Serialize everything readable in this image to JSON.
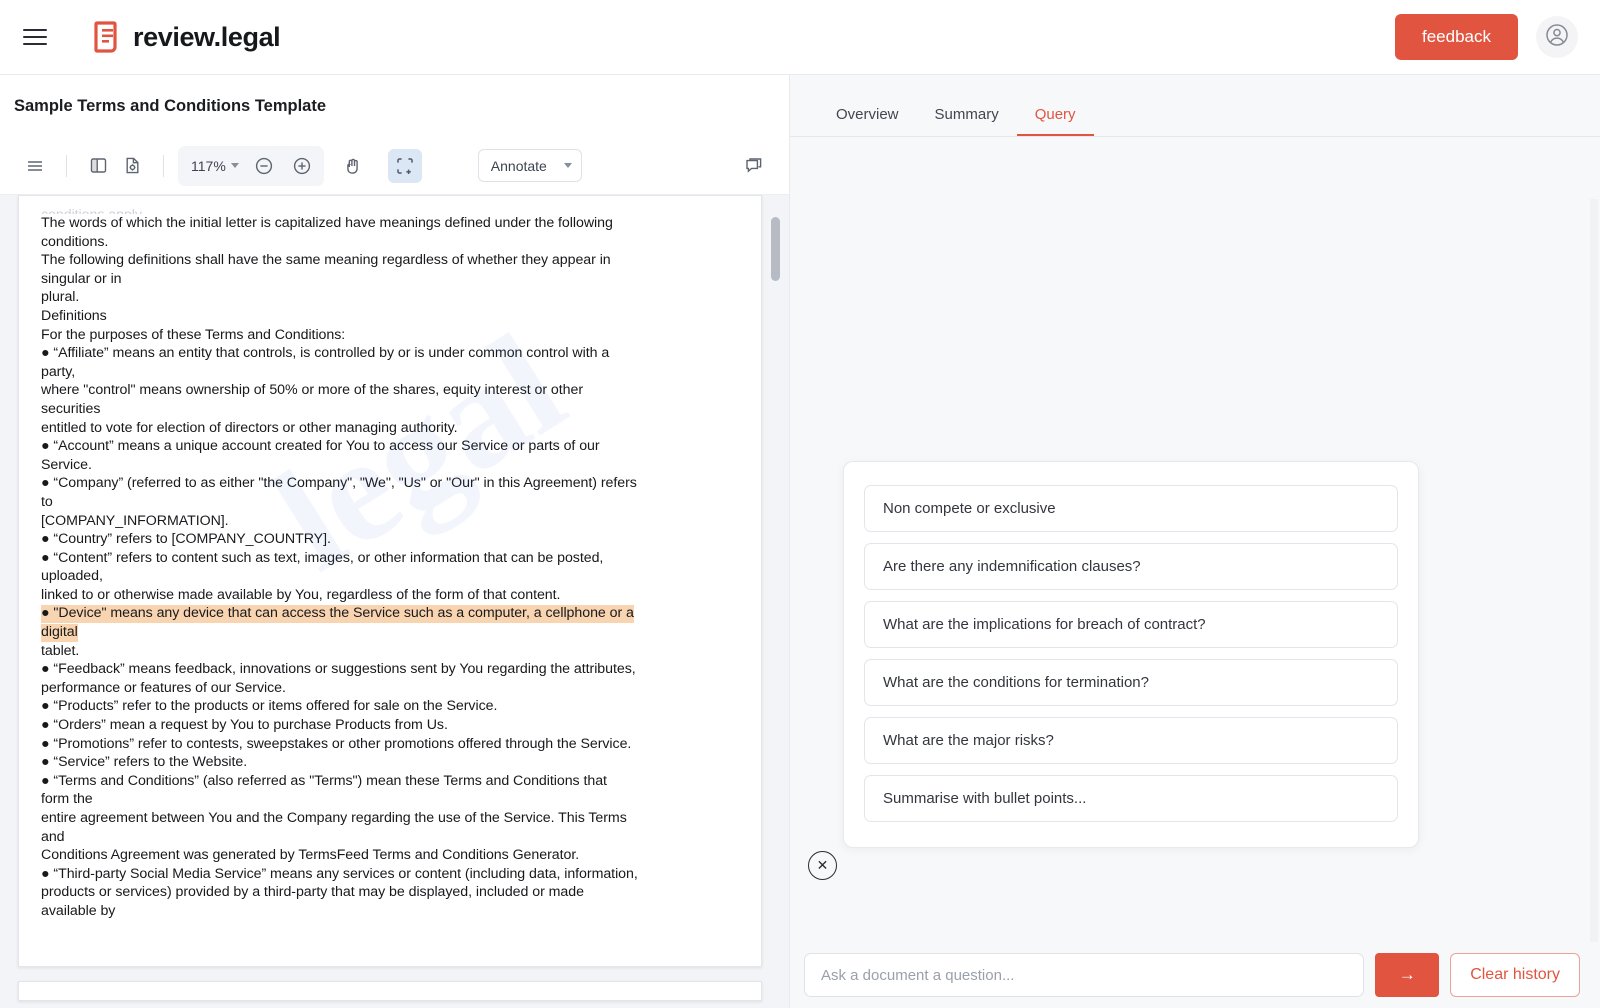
{
  "accent": "#e15540",
  "header": {
    "menu_icon": "hamburger-icon",
    "brand": "review.legal",
    "feedback_label": "feedback",
    "account_icon": "user-circle-icon"
  },
  "document": {
    "title": "Sample Terms and Conditions Template",
    "toolbar": {
      "sidebar_icon": "list-lines-icon",
      "layout_icon": "panel-split-icon",
      "page_settings_icon": "document-gear-icon",
      "zoom_value": "117%",
      "zoom_out_icon": "minus-circle-icon",
      "zoom_in_icon": "plus-circle-icon",
      "pan_icon": "hand-icon",
      "select_area_icon": "marquee-add-icon",
      "annotate_label": "Annotate",
      "annotate_options": [
        "Annotate"
      ],
      "comment_icon": "comment-icon"
    },
    "watermark": "legal",
    "lines": [
      {
        "text": "conditions apply",
        "style": "clipped"
      },
      {
        "text": "The words of which the initial letter is capitalized have meanings defined under the following",
        "style": "normal"
      },
      {
        "text": "conditions.",
        "style": "normal"
      },
      {
        "text": "The following definitions shall have the same meaning regardless of whether they appear in",
        "style": "normal"
      },
      {
        "text": "singular or in",
        "style": "normal"
      },
      {
        "text": "plural.",
        "style": "normal"
      },
      {
        "text": "Definitions",
        "style": "normal"
      },
      {
        "text": "For the purposes of these Terms and Conditions:",
        "style": "normal"
      },
      {
        "text": "● “Affiliate” means an entity that controls, is controlled by or is under common control with a",
        "style": "normal"
      },
      {
        "text": "party,",
        "style": "normal"
      },
      {
        "text": "where \"control\" means ownership of 50% or more of the shares, equity interest or other",
        "style": "normal"
      },
      {
        "text": "securities",
        "style": "normal"
      },
      {
        "text": "entitled to vote for election of directors or other managing authority.",
        "style": "normal"
      },
      {
        "text": "● “Account” means a unique account created for You to access our Service or parts of our",
        "style": "normal"
      },
      {
        "text": "Service.",
        "style": "normal"
      },
      {
        "text": "● “Company” (referred to as either \"the Company\", \"We\", \"Us\" or \"Our\" in this Agreement) refers",
        "style": "normal"
      },
      {
        "text": "to",
        "style": "normal"
      },
      {
        "text": "[COMPANY_INFORMATION].",
        "style": "normal"
      },
      {
        "text": "● “Country” refers to [COMPANY_COUNTRY].",
        "style": "normal"
      },
      {
        "text": "● “Content” refers to content such as text, images, or other information that can be posted,",
        "style": "normal"
      },
      {
        "text": "uploaded,",
        "style": "normal"
      },
      {
        "text": "linked to or otherwise made available by You, regardless of the form of that content.",
        "style": "normal"
      },
      {
        "text": "● \"Device\" means any device that can access the Service such as a computer, a cellphone or a",
        "style": "highlight"
      },
      {
        "text": "digital",
        "style": "highlight"
      },
      {
        "text": "tablet.",
        "style": "normal"
      },
      {
        "text": "● “Feedback” means feedback, innovations or suggestions sent by You regarding the attributes,",
        "style": "normal"
      },
      {
        "text": "performance or features of our Service.",
        "style": "normal"
      },
      {
        "text": "● “Products” refer to the products or items offered for sale on the Service.",
        "style": "normal"
      },
      {
        "text": "● “Orders” mean a request by You to purchase Products from Us.",
        "style": "normal"
      },
      {
        "text": "● “Promotions” refer to contests, sweepstakes or other promotions offered through the Service.",
        "style": "normal"
      },
      {
        "text": "● “Service” refers to the Website.",
        "style": "normal"
      },
      {
        "text": "● “Terms and Conditions” (also referred as \"Terms\") mean these Terms and Conditions that",
        "style": "normal"
      },
      {
        "text": "form the",
        "style": "normal"
      },
      {
        "text": "entire agreement between You and the Company regarding the use of the Service. This Terms",
        "style": "normal"
      },
      {
        "text": "and",
        "style": "normal"
      },
      {
        "text": "Conditions Agreement was generated by TermsFeed Terms and Conditions Generator.",
        "style": "normal"
      },
      {
        "text": "● “Third-party Social Media Service” means any services or content (including data, information,",
        "style": "normal"
      },
      {
        "text": "products or services) provided by a third-party that may be displayed, included or made",
        "style": "normal"
      },
      {
        "text": "available by",
        "style": "normal"
      }
    ]
  },
  "query_panel": {
    "tabs": [
      {
        "label": "Overview",
        "active": false
      },
      {
        "label": "Summary",
        "active": false
      },
      {
        "label": "Query",
        "active": true
      }
    ],
    "suggestions": [
      "Non compete or exclusive",
      "Are there any indemnification clauses?",
      "What are the implications for breach of contract?",
      "What are the conditions for termination?",
      "What are the major risks?",
      "Summarise with bullet points..."
    ],
    "close_icon": "close-x-icon",
    "input_placeholder": "Ask a document a question...",
    "input_value": "",
    "send_icon": "arrow-right-icon",
    "clear_history_label": "Clear history"
  }
}
